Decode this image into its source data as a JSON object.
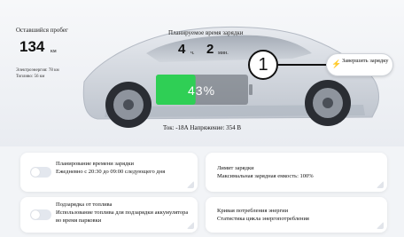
{
  "status": {
    "range_label": "Оставшийся пробег",
    "range_value": "134",
    "range_unit": "км",
    "electric_range": "Электроэнергия: 78 км",
    "fuel_range": "Топливо: 56 км"
  },
  "charge_time": {
    "label": "Планируемое время зарядки",
    "hours": "4",
    "hours_unit": "ч.",
    "minutes": "2",
    "minutes_unit": "мин."
  },
  "battery": {
    "percent_text": "43%",
    "level": 0.43
  },
  "callout": {
    "number": "1"
  },
  "stop_button": {
    "label": "Завершить зарядку",
    "icon": "lightning-bolt-icon"
  },
  "electrical": {
    "text": "Ток: -18А Напряжение: 354 В"
  },
  "cards": {
    "schedule": {
      "title": "Планирование времени зарядки",
      "desc": "Ежедневно с 20:30 до 09:00 следующего дня"
    },
    "charge_limit": {
      "title": "Лимит зарядки",
      "desc": "Максимальная зарядная емкость: 100%"
    },
    "fuel_charge": {
      "title": "Подзарядка от топлива",
      "desc": "Использование топлива для подзарядки аккумулятора во время парковки"
    },
    "energy_curve": {
      "title": "Кривая потребления энергии",
      "desc": "Статистика цикла энергопотребления"
    }
  },
  "colors": {
    "battery_fill": "#2fcf55",
    "accent": "#111111",
    "toggle_off": "#e3e7ee"
  }
}
